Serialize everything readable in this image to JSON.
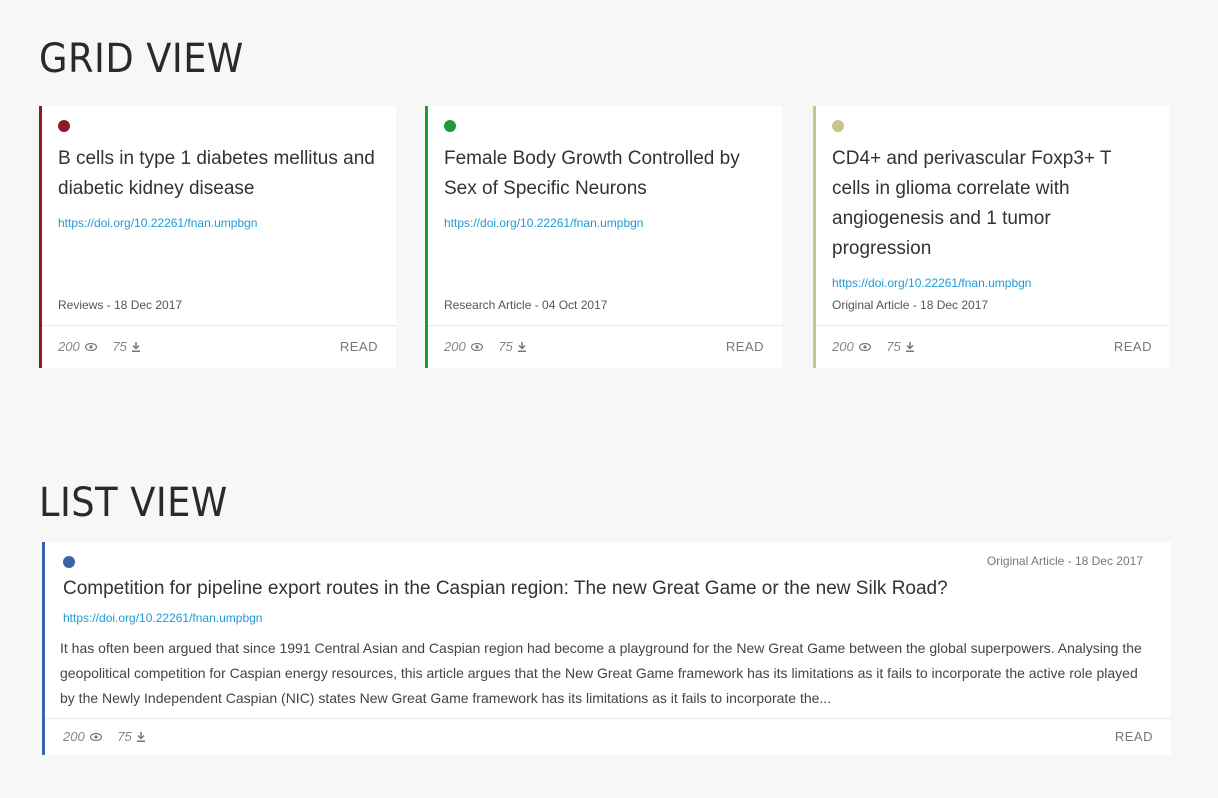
{
  "grid_view": {
    "title": "GRID VIEW",
    "cards": [
      {
        "title": "B cells in type 1 diabetes mellitus and diabetic kidney disease",
        "doi": "https://doi.org/10.22261/fnan.umpbgn",
        "meta": "Reviews - 18 Dec 2017",
        "views": "200",
        "downloads": "75",
        "read_label": "READ",
        "accent_color": "#8c1a28",
        "views_icon": "eye-icon",
        "downloads_icon": "download-icon"
      },
      {
        "title": "Female Body Growth Controlled by Sex of Specific Neurons",
        "doi": "https://doi.org/10.22261/fnan.umpbgn",
        "meta": "Research Article - 04 Oct 2017",
        "views": "200",
        "downloads": "75",
        "read_label": "READ",
        "accent_color": "#1f9a36",
        "views_icon": "eye-icon",
        "downloads_icon": "download-icon"
      },
      {
        "title": "CD4+ and perivascular Foxp3+ T cells in glioma correlate with angiogenesis and 1 tumor progression",
        "doi": "https://doi.org/10.22261/fnan.umpbgn",
        "meta": "Original Article - 18 Dec 2017",
        "views": "200",
        "downloads": "75",
        "read_label": "READ",
        "accent_color": "#c8c48e",
        "views_icon": "eye-icon",
        "downloads_icon": "download-icon"
      }
    ]
  },
  "list_view": {
    "title": "LIST VIEW",
    "card": {
      "meta": "Original Article - 18 Dec 2017",
      "title": "Competition for pipeline export routes in the Caspian region: The new Great Game or the new Silk Road?",
      "doi": "https://doi.org/10.22261/fnan.umpbgn",
      "abstract": "It has often been argued that since 1991 Central Asian and Caspian region had become a playground for the New Great Game between the global superpowers. Analysing the geopolitical competition for Caspian energy resources, this article argues that the New Great Game framework has its limitations as it fails to incorporate the active role played by the Newly Independent Caspian (NIC) states New Great Game framework has its limitations as it fails to incorporate the...",
      "views": "200",
      "downloads": "75",
      "read_label": "READ",
      "accent_color": "#3a64a8",
      "views_icon": "eye-icon",
      "downloads_icon": "download-icon"
    }
  }
}
